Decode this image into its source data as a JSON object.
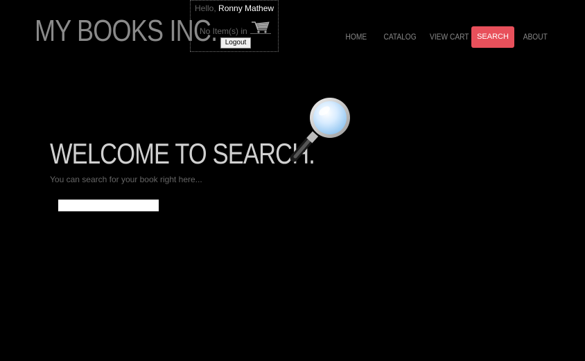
{
  "header": {
    "logo_text": "MY BOOKS INC.",
    "greeting": "Hello,",
    "user_name": "Ronny Mathew",
    "cart_status": "No Item(s) in",
    "logout_label": "Logout"
  },
  "nav": {
    "items": [
      {
        "label": "HOME"
      },
      {
        "label": "CATALOG"
      },
      {
        "label": "VIEW CART"
      },
      {
        "label": "SEARCH"
      },
      {
        "label": "ABOUT"
      }
    ],
    "active": "SEARCH",
    "active_color": "#e8505b"
  },
  "main": {
    "title": "WELCOME TO SEARCH.",
    "subtitle": "You can search for your book right here...",
    "search_value": "",
    "search_placeholder": "",
    "illustration_icon": "magnifier-icon"
  }
}
